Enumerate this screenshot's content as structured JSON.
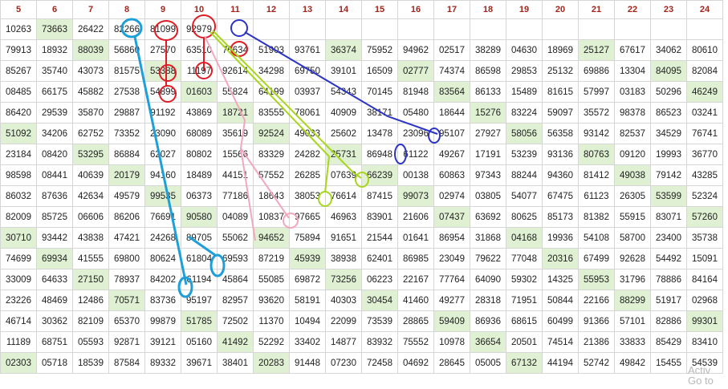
{
  "headers": [
    "5",
    "6",
    "7",
    "8",
    "9",
    "10",
    "11",
    "12",
    "13",
    "14",
    "15",
    "16",
    "17",
    "18",
    "19",
    "20",
    "21",
    "22",
    "23",
    "24"
  ],
  "rows": [
    {
      "cells": [
        "10263",
        "73663",
        "26422",
        "82266",
        "81099",
        "92979",
        "",
        "",
        "",
        "",
        "",
        "",
        "",
        "",
        "",
        "",
        "",
        "",
        "",
        ""
      ],
      "hl": [
        1,
        8,
        15
      ]
    },
    {
      "cells": [
        "79913",
        "18932",
        "88039",
        "56860",
        "27570",
        "63510",
        "76634",
        "51903",
        "93761",
        "36374",
        "75952",
        "94962",
        "02517",
        "38289",
        "04630",
        "18969",
        "25127",
        "67617",
        "34062",
        "80610"
      ],
      "hl": [
        2,
        9,
        16
      ]
    },
    {
      "cells": [
        "85267",
        "35740",
        "43073",
        "81575",
        "53388",
        "11197",
        "92614",
        "34298",
        "69750",
        "39101",
        "16509",
        "02777",
        "74374",
        "86598",
        "29853",
        "25132",
        "69886",
        "13304",
        "84095",
        "82084"
      ],
      "hl": [
        4,
        11,
        18
      ]
    },
    {
      "cells": [
        "08485",
        "66175",
        "45882",
        "27538",
        "54899",
        "01603",
        "55824",
        "64199",
        "03937",
        "54343",
        "70145",
        "81948",
        "83564",
        "86133",
        "15489",
        "81615",
        "57997",
        "03183",
        "50296",
        "46249"
      ],
      "hl": [
        5,
        12,
        19
      ]
    },
    {
      "cells": [
        "86420",
        "29539",
        "35870",
        "29887",
        "91192",
        "43869",
        "18721",
        "83555",
        "78061",
        "40909",
        "38171",
        "05480",
        "18644",
        "15276",
        "83224",
        "59097",
        "35572",
        "98378",
        "86523",
        "03241"
      ],
      "hl": [
        6,
        13
      ]
    },
    {
      "cells": [
        "51092",
        "34206",
        "62752",
        "73352",
        "23090",
        "68089",
        "35619",
        "92524",
        "49033",
        "25602",
        "13478",
        "23096",
        "95107",
        "27927",
        "58056",
        "56358",
        "93142",
        "82537",
        "34529",
        "76741"
      ],
      "hl": [
        0,
        7,
        14
      ]
    },
    {
      "cells": [
        "23184",
        "08420",
        "53295",
        "86884",
        "62027",
        "80802",
        "15566",
        "83329",
        "24282",
        "25731",
        "86948",
        "61122",
        "49267",
        "17191",
        "53239",
        "93136",
        "80763",
        "09120",
        "19993",
        "36770"
      ],
      "hl": [
        2,
        9,
        16
      ]
    },
    {
      "cells": [
        "98598",
        "08441",
        "40639",
        "20179",
        "94160",
        "18489",
        "44151",
        "57552",
        "26285",
        "07639",
        "66239",
        "00138",
        "60863",
        "97343",
        "88244",
        "94360",
        "81412",
        "49038",
        "79142",
        "43285"
      ],
      "hl": [
        3,
        10,
        17
      ]
    },
    {
      "cells": [
        "86032",
        "87636",
        "42634",
        "49579",
        "99535",
        "06373",
        "77186",
        "18643",
        "38053",
        "76614",
        "87415",
        "99073",
        "02974",
        "03805",
        "54077",
        "67475",
        "61123",
        "26305",
        "53599",
        "52324"
      ],
      "hl": [
        4,
        11,
        18
      ]
    },
    {
      "cells": [
        "82009",
        "85725",
        "06606",
        "86206",
        "76691",
        "90580",
        "04089",
        "10837",
        "97665",
        "46963",
        "83901",
        "21606",
        "07437",
        "63692",
        "80625",
        "85173",
        "81382",
        "55915",
        "83071",
        "57260"
      ],
      "hl": [
        5,
        12,
        19
      ]
    },
    {
      "cells": [
        "30710",
        "93442",
        "43838",
        "47421",
        "24268",
        "89705",
        "55062",
        "94652",
        "75894",
        "91651",
        "21544",
        "01641",
        "86954",
        "31868",
        "04168",
        "19936",
        "54108",
        "58700",
        "23400",
        "35738"
      ],
      "hl": [
        0,
        7,
        14
      ]
    },
    {
      "cells": [
        "74699",
        "69934",
        "41555",
        "69800",
        "80624",
        "61804",
        "69593",
        "87219",
        "45939",
        "38938",
        "62401",
        "86985",
        "23049",
        "79622",
        "77048",
        "20316",
        "67499",
        "92628",
        "54492",
        "15091"
      ],
      "hl": [
        1,
        8,
        15
      ]
    },
    {
      "cells": [
        "33009",
        "64633",
        "27150",
        "78937",
        "84202",
        "61194",
        "45864",
        "55085",
        "69872",
        "73256",
        "06223",
        "22167",
        "77764",
        "64090",
        "59302",
        "14325",
        "55953",
        "31796",
        "78886",
        "84164"
      ],
      "hl": [
        2,
        9,
        16
      ]
    },
    {
      "cells": [
        "23226",
        "48469",
        "12486",
        "70571",
        "83736",
        "95197",
        "82957",
        "93620",
        "58191",
        "40303",
        "30454",
        "41460",
        "49277",
        "28318",
        "71951",
        "50844",
        "22166",
        "88299",
        "51917",
        "02968"
      ],
      "hl": [
        3,
        10,
        17
      ]
    },
    {
      "cells": [
        "46714",
        "30362",
        "82109",
        "65370",
        "99879",
        "51785",
        "72502",
        "11370",
        "10494",
        "22099",
        "73539",
        "28865",
        "59409",
        "86936",
        "68615",
        "60499",
        "91366",
        "57101",
        "82886",
        "99301"
      ],
      "hl": [
        5,
        12,
        19
      ]
    },
    {
      "cells": [
        "11189",
        "68751",
        "05593",
        "92871",
        "39121",
        "05160",
        "41492",
        "52292",
        "33402",
        "14877",
        "83932",
        "75552",
        "10978",
        "36654",
        "20501",
        "74514",
        "21386",
        "33833",
        "85429",
        "83410"
      ],
      "hl": [
        6,
        13
      ]
    },
    {
      "cells": [
        "02303",
        "05718",
        "18539",
        "87584",
        "89332",
        "39671",
        "38401",
        "20283",
        "91448",
        "07230",
        "72458",
        "04692",
        "28645",
        "05005",
        "67132",
        "44194",
        "52742",
        "49842",
        "15455",
        "54539"
      ],
      "hl": [
        0,
        7,
        14
      ]
    }
  ],
  "watermark": {
    "line1": "Activ",
    "line2": "Go to"
  },
  "colors": {
    "highlight": "#dff0d3",
    "header_text": "#a0251b",
    "red": "#e01b24",
    "blue": "#2b34c6",
    "cyan": "#1e9fd8",
    "lime": "#a8d61c",
    "pink": "#f3a7bd"
  }
}
